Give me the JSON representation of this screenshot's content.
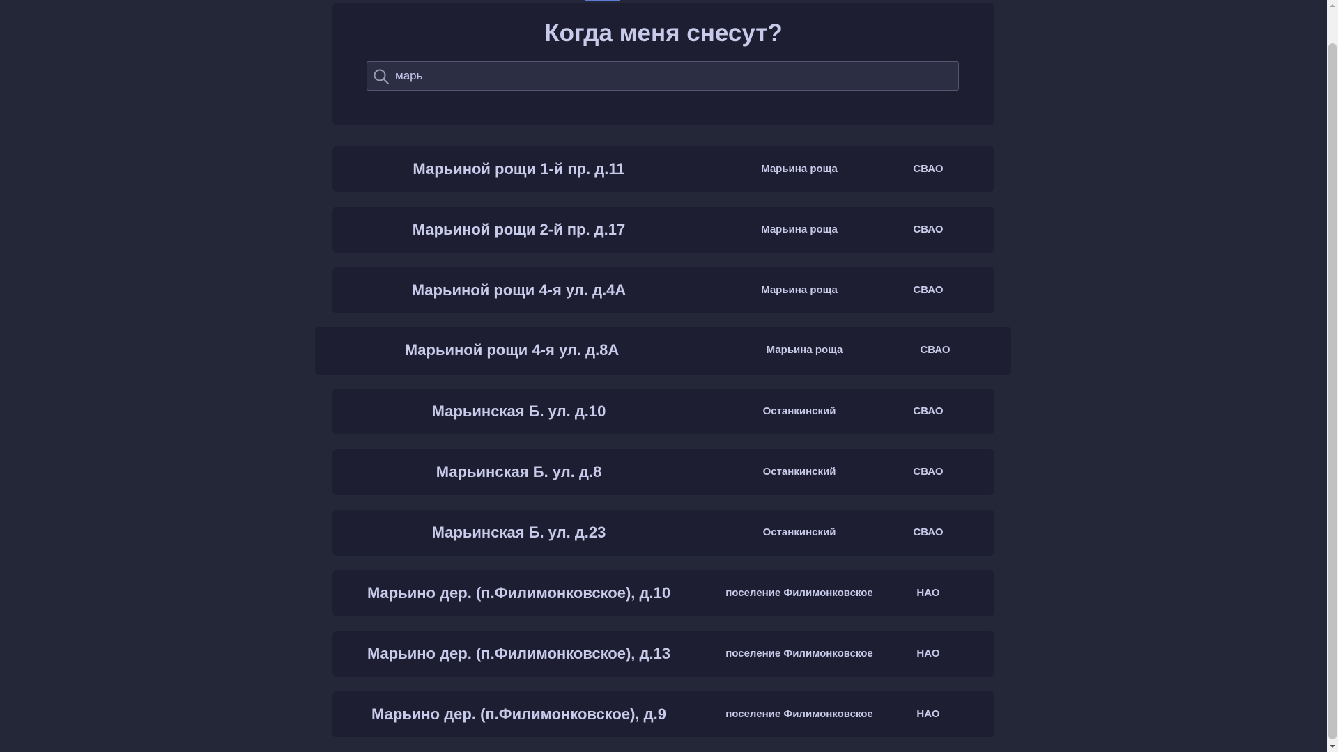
{
  "header": {
    "title": "Когда меня снесут?"
  },
  "search": {
    "value": "марь",
    "icon": "search-icon"
  },
  "results": [
    {
      "address": "Марьиной рощи 1-й пр. д.11",
      "district": "Марьина роща",
      "okrug": "СВАО"
    },
    {
      "address": "Марьиной рощи 2-й пр. д.17",
      "district": "Марьина роща",
      "okrug": "СВАО"
    },
    {
      "address": "Марьиной рощи 4-я ул. д.4А",
      "district": "Марьина роща",
      "okrug": "СВАО"
    },
    {
      "address": "Марьиной рощи 4-я ул. д.8А",
      "district": "Марьина роща",
      "okrug": "СВАО"
    },
    {
      "address": "Марьинская Б. ул. д.10",
      "district": "Останкинский",
      "okrug": "СВАО"
    },
    {
      "address": "Марьинская Б. ул. д.8",
      "district": "Останкинский",
      "okrug": "СВАО"
    },
    {
      "address": "Марьинская Б. ул. д.23",
      "district": "Останкинский",
      "okrug": "СВАО"
    },
    {
      "address": "Марьино дер. (п.Филимонковское), д.10",
      "district": "поселение Филимонковское",
      "okrug": "НАО"
    },
    {
      "address": "Марьино дер. (п.Филимонковское), д.13",
      "district": "поселение Филимонковское",
      "okrug": "НАО"
    },
    {
      "address": "Марьино дер. (п.Филимонковское), д.9",
      "district": "поселение Филимонковское",
      "okrug": "НАО"
    }
  ],
  "colors": {
    "background": "#242738",
    "panel": "#1d1e31",
    "text": "#c7cae9",
    "accent": "#5b7bd5"
  }
}
